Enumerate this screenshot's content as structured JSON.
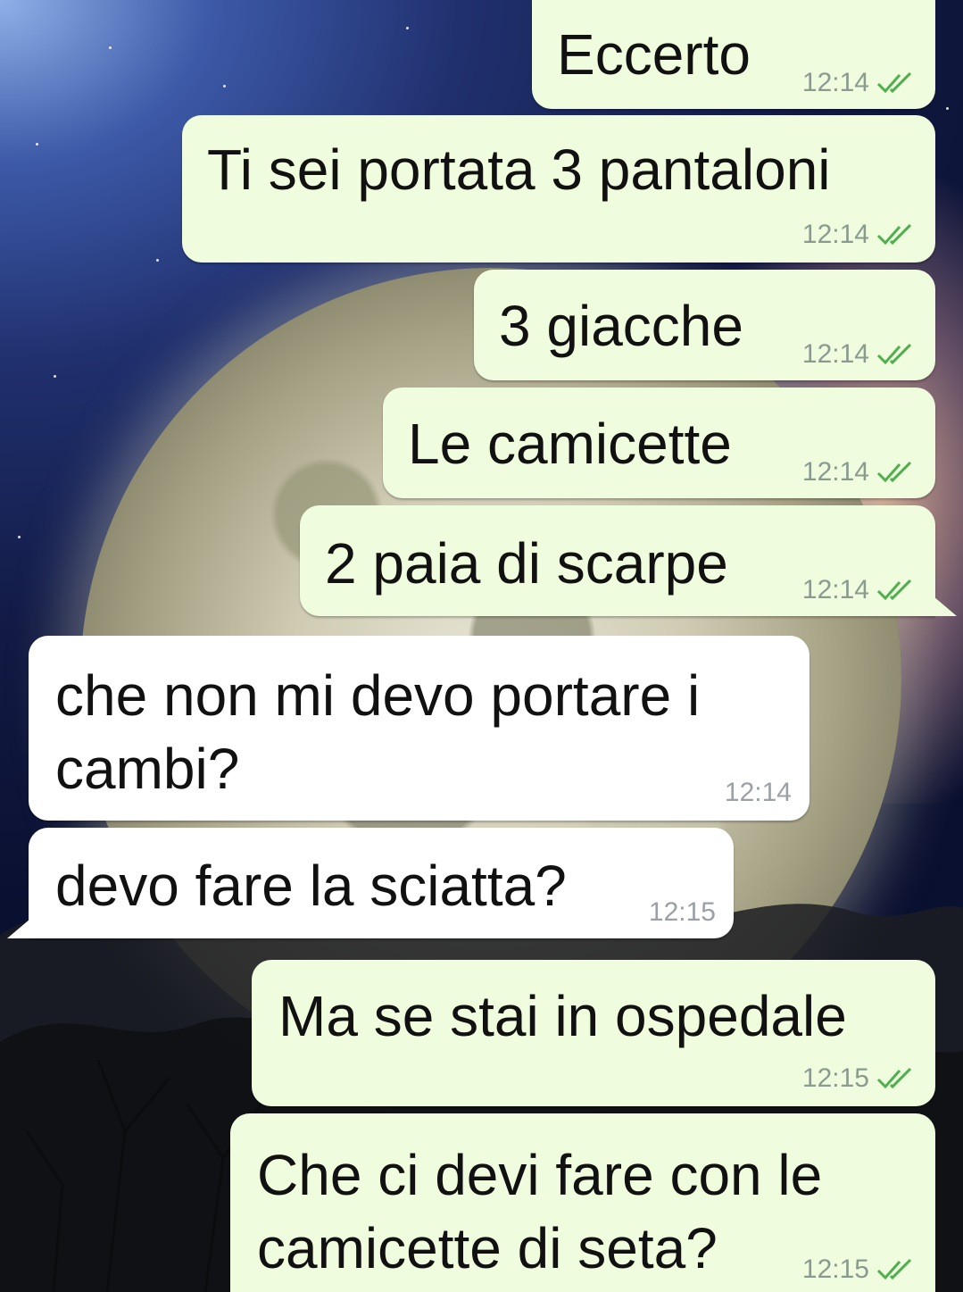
{
  "messages": [
    {
      "direction": "out",
      "text": "Eccerto",
      "time": "12:14",
      "status_icon": "double-check-icon"
    },
    {
      "direction": "out",
      "text": "Ti sei portata 3 pantaloni",
      "time": "12:14",
      "status_icon": "double-check-icon"
    },
    {
      "direction": "out",
      "text": "3 giacche",
      "time": "12:14",
      "status_icon": "double-check-icon"
    },
    {
      "direction": "out",
      "text": "Le camicette",
      "time": "12:14",
      "status_icon": "double-check-icon"
    },
    {
      "direction": "out",
      "text": "2 paia di scarpe",
      "time": "12:14",
      "status_icon": "double-check-icon"
    },
    {
      "direction": "in",
      "text_lines": [
        "che non mi devo portare i",
        "cambi?"
      ],
      "time": "12:14"
    },
    {
      "direction": "in",
      "text": "devo fare la sciatta?",
      "time": "12:15"
    },
    {
      "direction": "out",
      "text": "Ma se stai in ospedale",
      "time": "12:15",
      "status_icon": "double-check-icon"
    },
    {
      "direction": "out",
      "text_lines": [
        "Che ci devi fare con le",
        "camicette di seta?"
      ],
      "time": "12:15",
      "status_icon": "double-check-icon"
    }
  ],
  "colors": {
    "outgoing_bubble": "#effcde",
    "incoming_bubble": "#ffffff",
    "read_ticks": "#4fae4e",
    "timestamp": "#8a9a8e"
  }
}
